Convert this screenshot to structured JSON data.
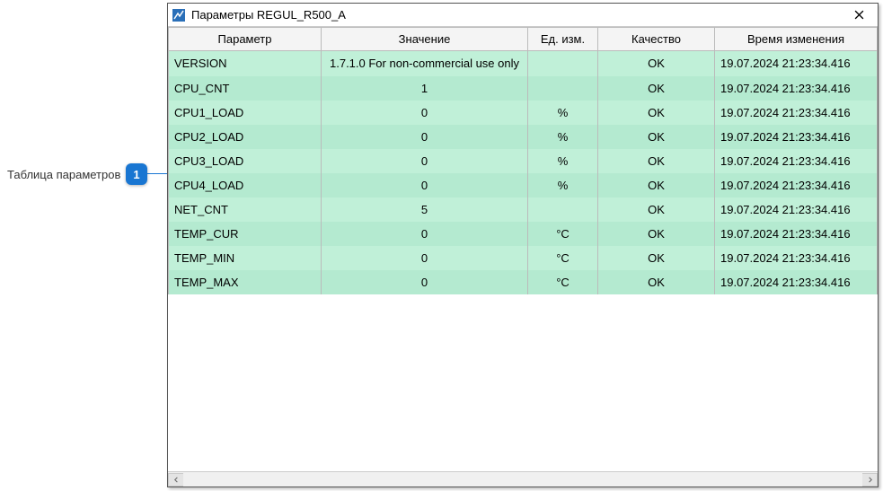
{
  "annotation": {
    "label": "Таблица параметров",
    "number": "1"
  },
  "window": {
    "title": "Параметры REGUL_R500_A"
  },
  "columns": [
    {
      "key": "param",
      "label": "Параметр"
    },
    {
      "key": "value",
      "label": "Значение"
    },
    {
      "key": "unit",
      "label": "Ед. изм."
    },
    {
      "key": "qual",
      "label": "Качество"
    },
    {
      "key": "time",
      "label": "Время изменения"
    }
  ],
  "rows": [
    {
      "param": "VERSION",
      "value": "1.7.1.0 For non-commercial use only",
      "unit": "",
      "qual": "OK",
      "time": "19.07.2024 21:23:34.416",
      "wrap": true
    },
    {
      "param": "CPU_CNT",
      "value": "1",
      "unit": "",
      "qual": "OK",
      "time": "19.07.2024 21:23:34.416"
    },
    {
      "param": "CPU1_LOAD",
      "value": "0",
      "unit": "%",
      "qual": "OK",
      "time": "19.07.2024 21:23:34.416"
    },
    {
      "param": "CPU2_LOAD",
      "value": "0",
      "unit": "%",
      "qual": "OK",
      "time": "19.07.2024 21:23:34.416"
    },
    {
      "param": "CPU3_LOAD",
      "value": "0",
      "unit": "%",
      "qual": "OK",
      "time": "19.07.2024 21:23:34.416"
    },
    {
      "param": "CPU4_LOAD",
      "value": "0",
      "unit": "%",
      "qual": "OK",
      "time": "19.07.2024 21:23:34.416"
    },
    {
      "param": "NET_CNT",
      "value": "5",
      "unit": "",
      "qual": "OK",
      "time": "19.07.2024 21:23:34.416"
    },
    {
      "param": "TEMP_CUR",
      "value": "0",
      "unit": "°C",
      "qual": "OK",
      "time": "19.07.2024 21:23:34.416"
    },
    {
      "param": "TEMP_MIN",
      "value": "0",
      "unit": "°C",
      "qual": "OK",
      "time": "19.07.2024 21:23:34.416"
    },
    {
      "param": "TEMP_MAX",
      "value": "0",
      "unit": "°C",
      "qual": "OK",
      "time": "19.07.2024 21:23:34.416"
    }
  ]
}
